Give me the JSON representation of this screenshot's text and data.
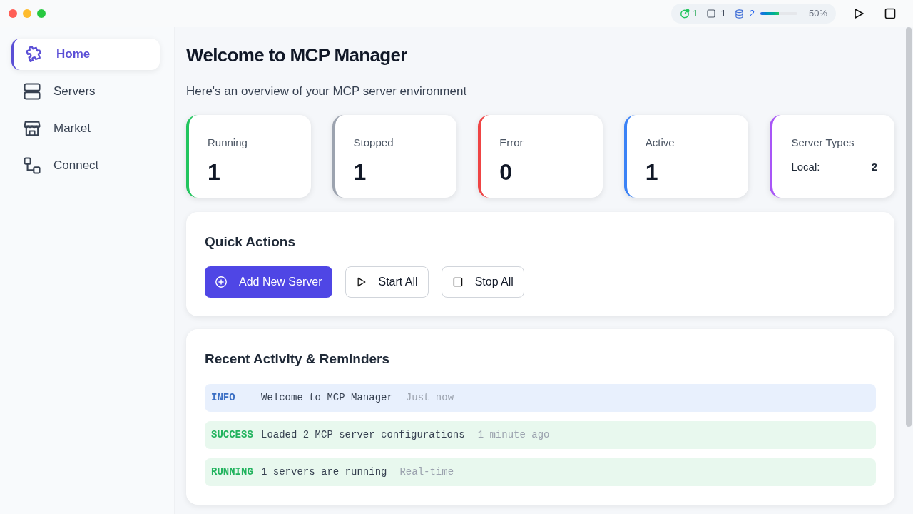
{
  "status": {
    "running": "1",
    "stopped": "1",
    "servers": "2",
    "level": 0.5,
    "percent": "50%"
  },
  "sidebar": {
    "items": [
      {
        "label": "Home",
        "kind": "puzzle",
        "selected": true
      },
      {
        "label": "Servers",
        "kind": "server",
        "selected": false
      },
      {
        "label": "Market",
        "kind": "store",
        "selected": false
      },
      {
        "label": "Connect",
        "kind": "connect",
        "selected": false
      }
    ]
  },
  "header": {
    "title": "Welcome to MCP Manager",
    "subtitle": "Here's an overview of your MCP server environment"
  },
  "stats": [
    {
      "kind": "count",
      "label": "Running",
      "value": "1",
      "color": "#22c55e"
    },
    {
      "kind": "count",
      "label": "Stopped",
      "value": "1",
      "color": "#9ca3af"
    },
    {
      "kind": "count",
      "label": "Error",
      "value": "0",
      "color": "#ef4444"
    },
    {
      "kind": "count",
      "label": "Active",
      "value": "1",
      "color": "#3b82f6"
    },
    {
      "kind": "types",
      "label": "Server Types",
      "rows": [
        {
          "name": "Local:",
          "count": "2"
        }
      ],
      "color": "#a855f7"
    }
  ],
  "quick_actions": {
    "title": "Quick Actions",
    "buttons": [
      {
        "kind": "add",
        "label": "Add New Server"
      },
      {
        "kind": "play",
        "label": "Start All"
      },
      {
        "kind": "stop",
        "label": "Stop All"
      }
    ]
  },
  "activity": {
    "title": "Recent Activity & Reminders",
    "items": [
      {
        "kind": "info",
        "tag": "INFO",
        "message": "Welcome to MCP Manager",
        "time": "Just now"
      },
      {
        "kind": "success",
        "tag": "SUCCESS",
        "message": "Loaded 2 MCP server configurations",
        "time": "1 minute ago"
      },
      {
        "kind": "running",
        "tag": "RUNNING",
        "message": "1 servers are running",
        "time": "Real-time"
      }
    ]
  }
}
